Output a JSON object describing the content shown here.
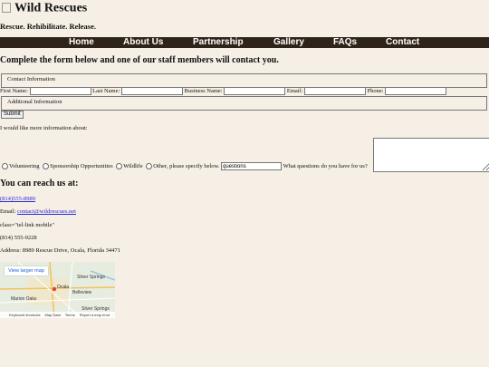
{
  "header": {
    "title": "Wild Rescues",
    "tagline": "Rescue. Rehibilitate. Release."
  },
  "nav": {
    "items": [
      "Home",
      "About Us",
      "Partnership",
      "Gallery",
      "FAQs",
      "Contact"
    ]
  },
  "form": {
    "heading": "Complete the form below and one of our staff members will contact you.",
    "contact_legend": "Contact Information",
    "fields": {
      "first_name": "First Name:",
      "last_name": "Last Name:",
      "business_name": "Business Name:",
      "email": "Email:",
      "phone": "Phone:"
    },
    "additional_legend": "Additional Information",
    "submit_label": "Submit",
    "more_info_label": "I would like more information about:",
    "options": [
      "Volunteering",
      "Sponsorship Opportunities",
      "Wildlife",
      "Other, please specify below."
    ],
    "specify_value": "questions",
    "question_label": "What questions do you have for us?"
  },
  "reach": {
    "heading": "You can reach us at:",
    "phone_link": "(814)555-8989",
    "email_prefix": "Email:",
    "email_link": "contact@wildrescues.net",
    "stray_text": "class=\"tel-link mobile\"",
    "phone_plain": "(814) 555-9228",
    "address": "Address: 8989 Rescue Drive, Ocala, Florida 34471"
  },
  "map": {
    "button_label": "View larger map",
    "places": [
      "Silver Springs",
      "Ocala",
      "Marion Oaks",
      "Belleview",
      "Silver Springs"
    ],
    "footer": [
      "Keyboard shortcuts",
      "Map Data",
      "Terms",
      "Report a map error"
    ]
  }
}
